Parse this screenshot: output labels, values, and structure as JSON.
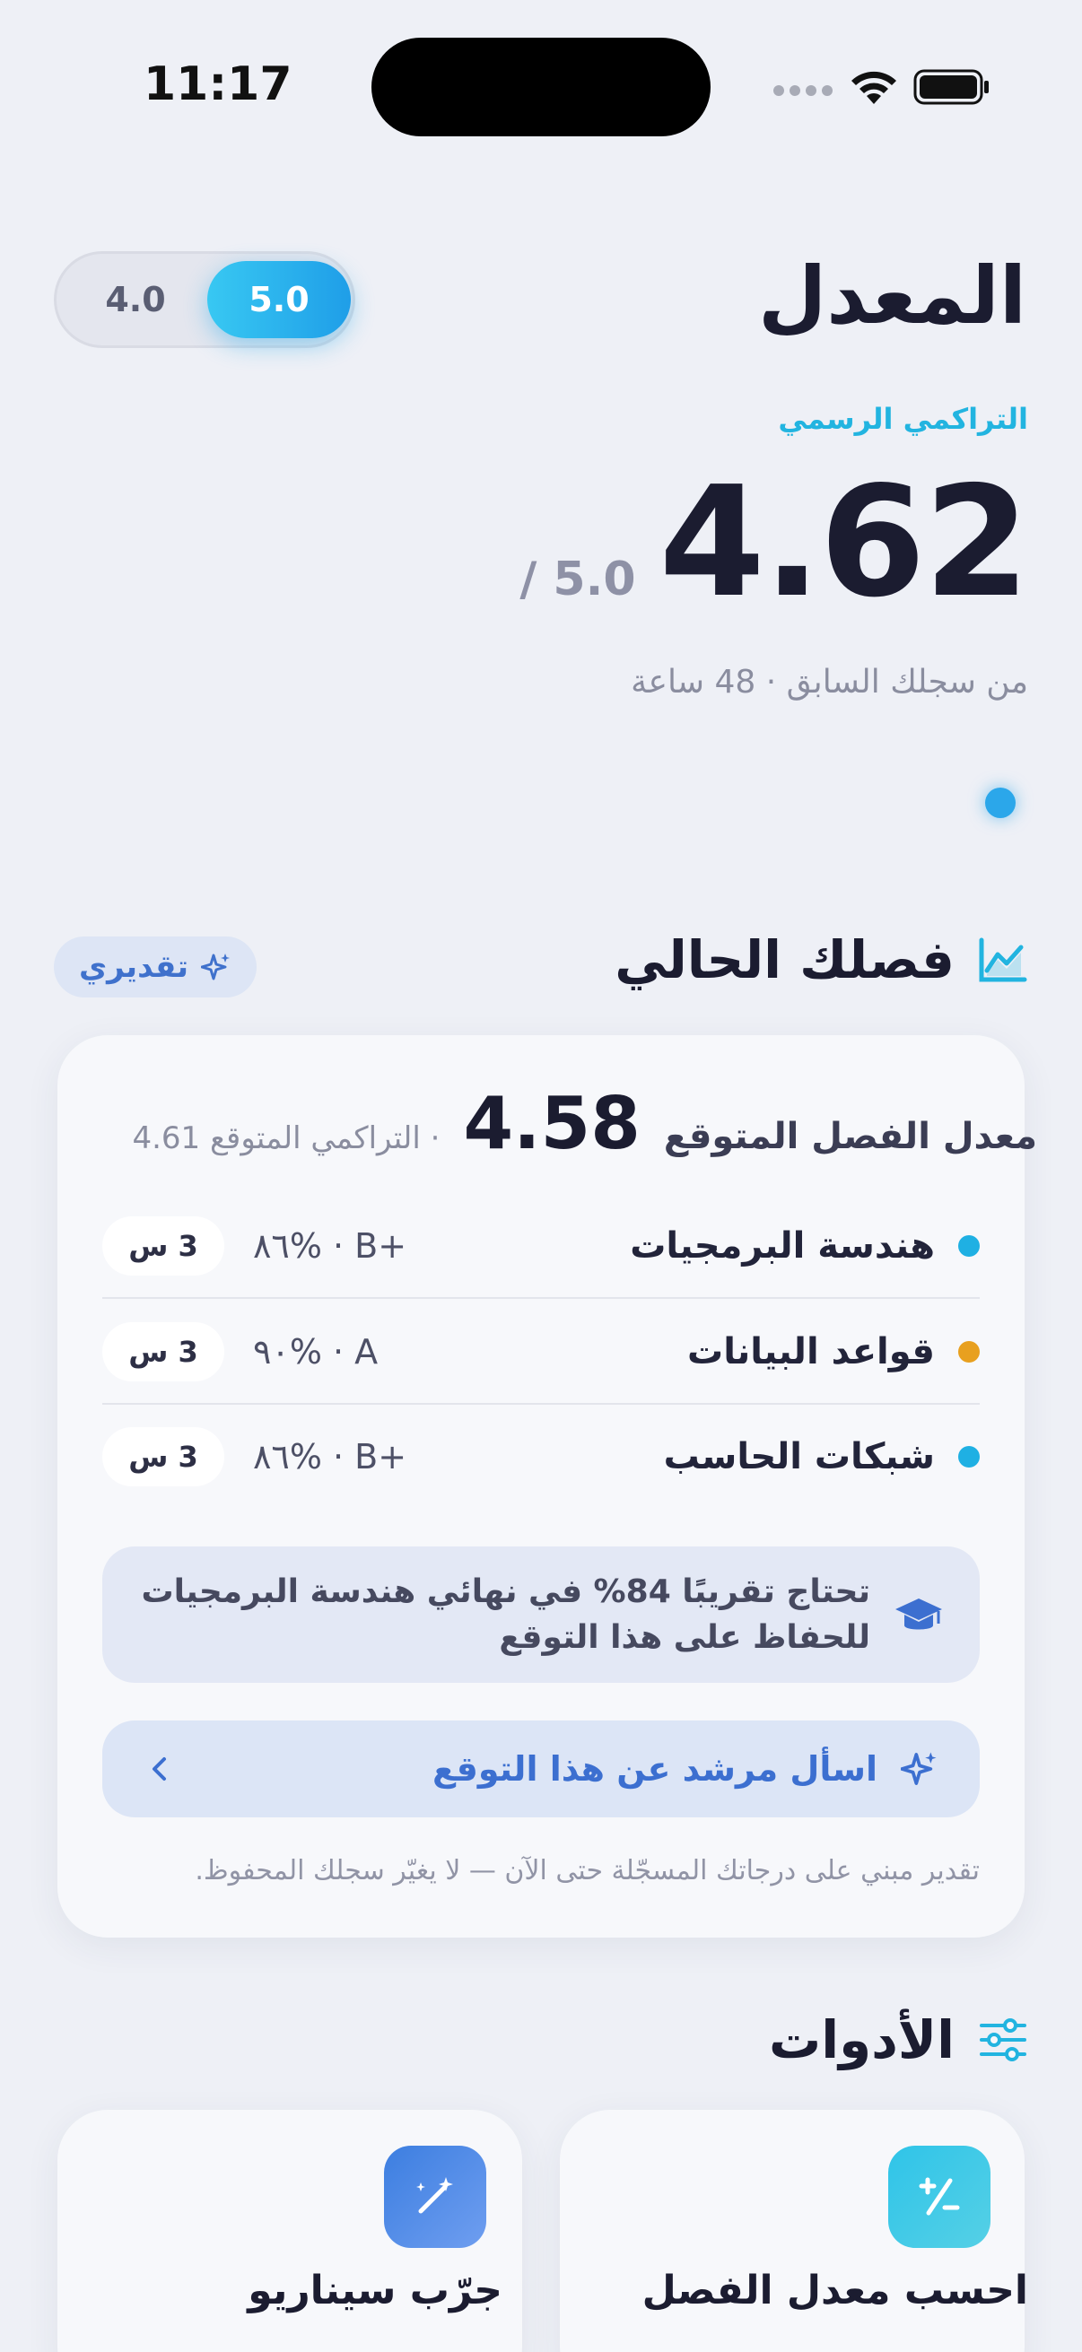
{
  "status_bar": {
    "time": "11:17"
  },
  "header": {
    "title": "المعدل",
    "scale_options": [
      "5.0",
      "4.0"
    ],
    "selected_scale": "5.0"
  },
  "gpa": {
    "label": "التراكمي الرسمي",
    "value": "4.62",
    "scale": "/ 5.0",
    "subtitle": "من سجلك السابق · 48 ساعة"
  },
  "semester": {
    "title": "فصلك الحالي",
    "badge": "تقديري",
    "expected_label": "معدل الفصل المتوقع",
    "expected_value": "4.58",
    "cumulative_text": "· التراكمي المتوقع 4.61",
    "courses": [
      {
        "name": "هندسة البرمجيات",
        "grade": "٨٦% · B+",
        "hours": "3 س",
        "color": "#1fb0e3"
      },
      {
        "name": "قواعد البيانات",
        "grade": "٩٠% · A",
        "hours": "3 س",
        "color": "#e8a01f"
      },
      {
        "name": "شبكات الحاسب",
        "grade": "٨٦% · B+",
        "hours": "3 س",
        "color": "#1fb0e3"
      }
    ],
    "tip_line1": "تحتاج تقريبًا 84% في نهائي هندسة البرمجيات",
    "tip_line2": "للحفاظ على هذا التوقع",
    "ask_label": "اسأل مرشد عن هذا التوقع",
    "disclaimer": "تقدير مبني على درجاتك المسجّلة حتى الآن — لا يغيّر سجلك المحفوظ."
  },
  "tools": {
    "title": "الأدوات",
    "items": [
      {
        "label": "احسب معدل الفصل",
        "icon": "plus-minus-icon"
      },
      {
        "label": "جرّب سيناريو",
        "icon": "magic-wand-icon"
      }
    ]
  },
  "colors": {
    "accent": "#22b4e0",
    "primary_blue": "#3c6fd0",
    "background": "#eef0f6"
  }
}
